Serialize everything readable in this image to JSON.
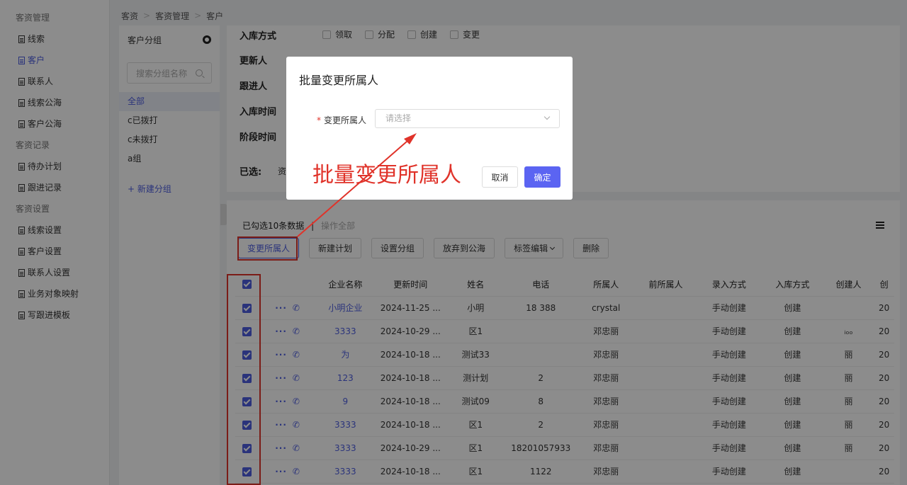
{
  "breadcrumb": [
    "客资",
    "客资管理",
    "客户"
  ],
  "sidebar": {
    "sections": [
      {
        "title": "客资管理",
        "items": [
          "线索",
          "客户",
          "联系人",
          "线索公海",
          "客户公海"
        ]
      },
      {
        "title": "客资记录",
        "items": [
          "待办计划",
          "跟进记录"
        ]
      },
      {
        "title": "客资设置",
        "items": [
          "线索设置",
          "客户设置",
          "联系人设置",
          "业务对象映射",
          "写跟进模板"
        ]
      }
    ]
  },
  "groups": {
    "title": "客户分组",
    "search_placeholder": "搜索分组名称",
    "items": [
      "全部",
      "c已拨打",
      "c未拨打",
      "a组"
    ],
    "add_label": "+ 新建分组"
  },
  "filter": {
    "rows": [
      "入库方式",
      "更新人",
      "跟进人",
      "入库时间",
      "阶段时间"
    ],
    "options": [
      "领取",
      "分配",
      "创建",
      "变更"
    ],
    "selected_label": "已选:",
    "selected_value": "资"
  },
  "table_panel": {
    "selection_info": "已勾选10条数据",
    "select_all": "操作全部",
    "toolbar": [
      "变更所属人",
      "新建计划",
      "设置分组",
      "放弃到公海",
      "标签编辑",
      "删除"
    ],
    "columns": [
      "企业名称",
      "更新时间",
      "姓名",
      "电话",
      "所属人",
      "前所属人",
      "录入方式",
      "入库方式",
      "创建人",
      "创"
    ],
    "rows": [
      {
        "company": "小明企业",
        "updated": "2024-11-25 ...",
        "name": "小明",
        "phone": "18 388",
        "owner": "crystal",
        "prev": "",
        "entry": "手动创建",
        "stock": "创建",
        "creator": "",
        "c": "20"
      },
      {
        "company": "3333",
        "updated": "2024-10-29 ...",
        "name": "区1",
        "phone": "",
        "owner": "邓忠丽",
        "prev": "",
        "entry": "手动创建",
        "stock": "创建",
        "creator": "ᵢₒₒ",
        "c": "20"
      },
      {
        "company": "为",
        "updated": "2024-10-18 ...",
        "name": "测试33",
        "phone": "",
        "owner": "邓忠丽",
        "prev": "",
        "entry": "手动创建",
        "stock": "创建",
        "creator": "丽",
        "c": "20"
      },
      {
        "company": "123",
        "updated": "2024-10-18 ...",
        "name": "测计划",
        "phone": "2",
        "owner": "邓忠丽",
        "prev": "",
        "entry": "手动创建",
        "stock": "创建",
        "creator": "丽",
        "c": "20"
      },
      {
        "company": "9",
        "updated": "2024-10-18 ...",
        "name": "测试09",
        "phone": "8",
        "owner": "邓忠丽",
        "prev": "",
        "entry": "手动创建",
        "stock": "创建",
        "creator": "丽",
        "c": "20"
      },
      {
        "company": "3333",
        "updated": "2024-10-18 ...",
        "name": "区1",
        "phone": "2",
        "owner": "邓忠丽",
        "prev": "",
        "entry": "手动创建",
        "stock": "创建",
        "creator": "丽",
        "c": "20"
      },
      {
        "company": "3333",
        "updated": "2024-10-29 ...",
        "name": "区1",
        "phone": "18201057933",
        "owner": "邓忠丽",
        "prev": "",
        "entry": "手动创建",
        "stock": "创建",
        "creator": "丽",
        "c": "20"
      },
      {
        "company": "3333",
        "updated": "2024-10-18 ...",
        "name": "区1",
        "phone": "1122",
        "owner": "邓忠丽",
        "prev": "",
        "entry": "手动创建",
        "stock": "创建",
        "creator": "",
        "c": "20"
      }
    ]
  },
  "modal": {
    "title": "批量变更所属人",
    "field_label": "变更所属人",
    "required_mark": "*",
    "select_placeholder": "请选择",
    "cancel_label": "取消",
    "ok_label": "确定"
  },
  "annotation": "批量变更所属人",
  "colors": {
    "accent": "#4e5ee0",
    "annotation": "#e0332a",
    "overlay": "rgba(0,0,0,0.45)"
  }
}
